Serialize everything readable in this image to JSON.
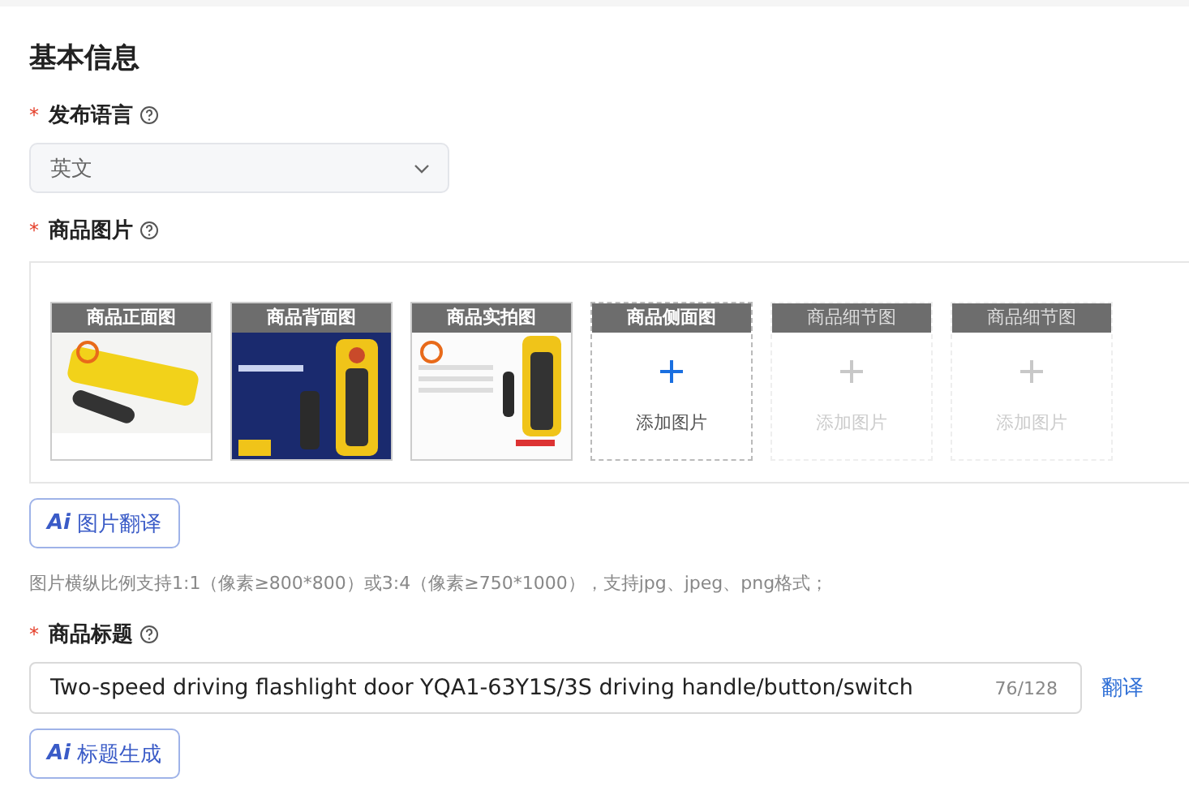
{
  "section_title": "基本信息",
  "language": {
    "label": "发布语言",
    "required_mark": "*",
    "value": "英文"
  },
  "images": {
    "label": "商品图片",
    "required_mark": "*",
    "slots": [
      {
        "label": "商品正面图"
      },
      {
        "label": "商品背面图"
      },
      {
        "label": "商品实拍图"
      },
      {
        "kind": "upload",
        "label": "商品侧面图",
        "action": "添加图片",
        "disabled": false
      },
      {
        "kind": "upload",
        "label": "商品细节图",
        "action": "添加图片",
        "disabled": true
      },
      {
        "kind": "upload",
        "label": "商品细节图",
        "action": "添加图片",
        "disabled": true
      }
    ],
    "ai_button": {
      "badge": "Ai",
      "label": "图片翻译"
    },
    "hint": "图片横纵比例支持1:1（像素≥800*800）或3:4（像素≥750*1000），支持jpg、jpeg、png格式；"
  },
  "title": {
    "label": "商品标题",
    "required_mark": "*",
    "value": "Two-speed driving flashlight door YQA1-63Y1S/3S driving handle/button/switch",
    "counter": "76/128",
    "translate_link": "翻译",
    "ai_button": {
      "badge": "Ai",
      "label": "标题生成"
    }
  }
}
